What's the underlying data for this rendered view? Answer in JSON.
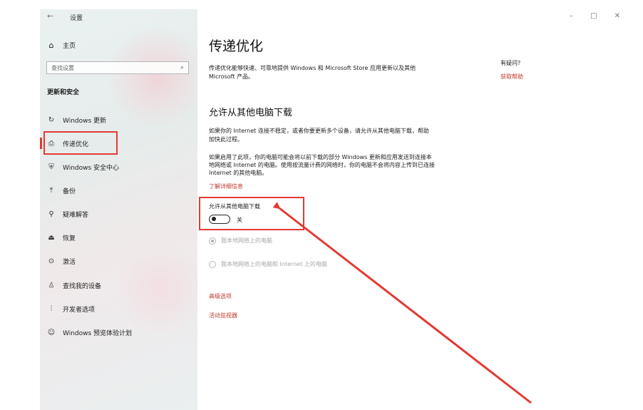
{
  "window": {
    "back_icon": "back-arrow-icon",
    "title": "设置",
    "controls": {
      "minimize": "–",
      "maximize": "□",
      "close": "✕"
    }
  },
  "sidebar": {
    "home": {
      "icon": "home-icon",
      "label": "主页"
    },
    "search": {
      "placeholder": "查找设置",
      "icon": "search-icon"
    },
    "section_label": "更新和安全",
    "items": [
      {
        "icon": "refresh-icon",
        "label": "Windows 更新"
      },
      {
        "icon": "delivery-icon",
        "label": "传递优化",
        "selected": true
      },
      {
        "icon": "shield-icon",
        "label": "Windows 安全中心"
      },
      {
        "icon": "backup-icon",
        "label": "备份"
      },
      {
        "icon": "wrench-icon",
        "label": "疑难解答"
      },
      {
        "icon": "recovery-icon",
        "label": "恢复"
      },
      {
        "icon": "activation-icon",
        "label": "激活"
      },
      {
        "icon": "find-device-icon",
        "label": "查找我的设备"
      },
      {
        "icon": "developer-icon",
        "label": "开发者选项"
      },
      {
        "icon": "insider-icon",
        "label": "Windows 预览体验计划"
      }
    ]
  },
  "main": {
    "title": "传递优化",
    "description": "传递优化能够快速、可靠地提供 Windows 和 Microsoft Store 应用更新以及其他 Microsoft 产品。",
    "help": {
      "heading": "有疑问?",
      "link": "获取帮助"
    },
    "subtitle": "允许从其他电脑下载",
    "para1": "如果你的 Internet 连接不稳定，或者你要更新多个设备，请允许从其他电脑下载，帮助加快此过程。",
    "para2": "如果启用了此项，你的电脑可能会将以前下载的部分 Windows 更新和应用发送到连接本地网络或 Internet 的电脑。使用按流量计费的网络时，你的电脑不会将内容上传到已连接 Internet 的其他电脑。",
    "learn_more": "了解详细信息",
    "toggle": {
      "label": "允许从其他电脑下载",
      "state": "关",
      "on": false
    },
    "radios": [
      {
        "label": "我本地网络上的电脑",
        "checked": true
      },
      {
        "label": "我本地网络上的电脑和 Internet 上的电脑",
        "checked": false
      }
    ],
    "advanced_link": "高级选项",
    "monitor_link": "活动监视器"
  },
  "annotation_color": "#e23a33",
  "link_color": "#c0392b"
}
